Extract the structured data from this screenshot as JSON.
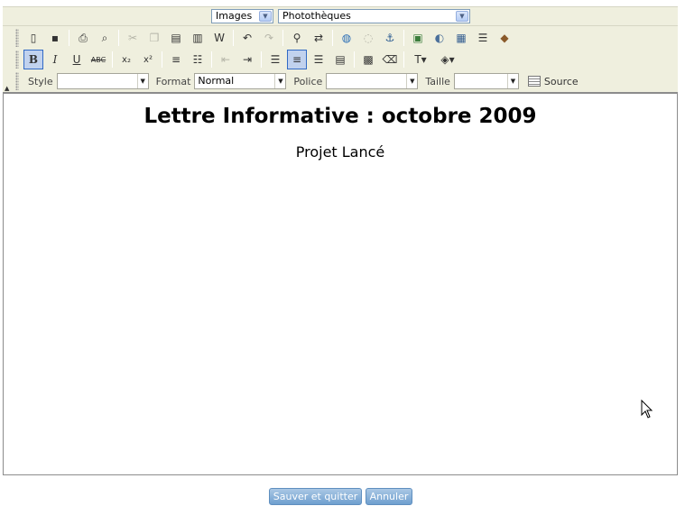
{
  "topbar": {
    "type_select": "Images",
    "library_select": "Photothèques"
  },
  "toolbar": {
    "style_label": "Style",
    "style_value": "",
    "format_label": "Format",
    "format_value": "Normal",
    "font_label": "Police",
    "font_value": "",
    "size_label": "Taille",
    "size_value": "",
    "source_label": "Source",
    "row1_icons": [
      "new-page-icon",
      "save-icon",
      "print-icon",
      "preview-icon",
      "cut-icon",
      "copy-icon",
      "paste-icon",
      "paste-text-icon",
      "paste-word-icon",
      "undo-icon",
      "redo-icon",
      "find-icon",
      "replace-icon",
      "link-icon",
      "unlink-icon",
      "anchor-icon",
      "image-icon",
      "flash-icon",
      "table-icon",
      "horizontal-rule-icon",
      "special-char-icon"
    ],
    "row2_icons": [
      "bold-icon",
      "italic-icon",
      "underline-icon",
      "strikethrough-icon",
      "subscript-icon",
      "superscript-icon",
      "numbered-list-icon",
      "bulleted-list-icon",
      "outdent-icon",
      "indent-icon",
      "align-left-icon",
      "align-center-icon",
      "align-right-icon",
      "align-justify-icon",
      "show-blocks-icon",
      "remove-format-icon",
      "text-color-icon",
      "background-color-icon"
    ]
  },
  "editor": {
    "title": "Lettre Informative : octobre 2009",
    "subtitle": "Projet Lancé"
  },
  "actions": {
    "save_label": "Sauver et quitter",
    "cancel_label": "Annuler"
  }
}
